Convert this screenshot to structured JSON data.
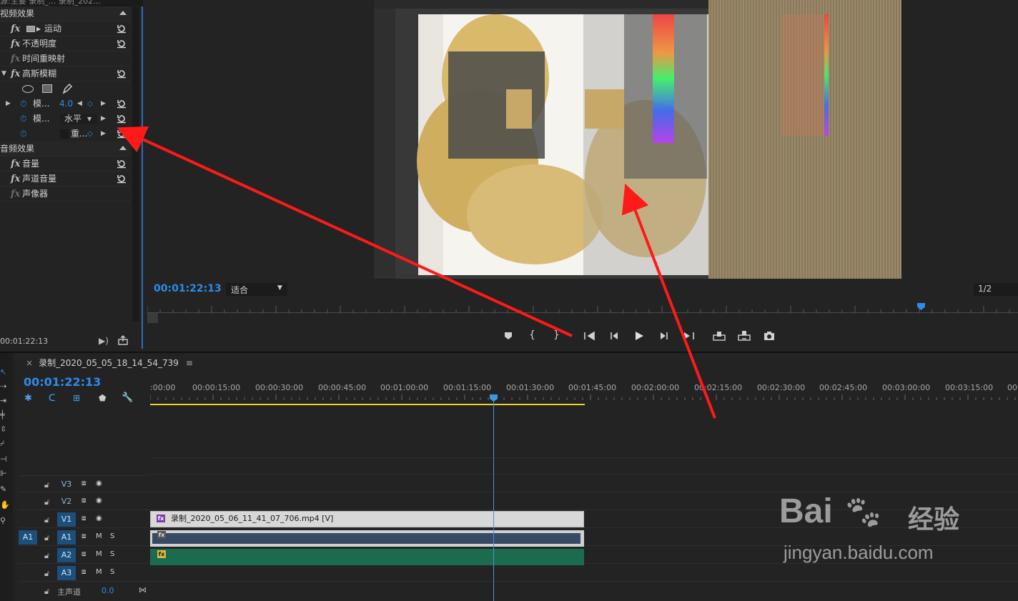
{
  "effect_controls": {
    "tabs_text": "源:主要   录制_...   录制_202...",
    "video_section": "视频效果",
    "effects": [
      "运动",
      "不透明度",
      "时间重映射",
      "高斯模糊"
    ],
    "props": [
      {
        "label": "模...",
        "value": "4.0"
      },
      {
        "label": "模...",
        "value": "水平"
      },
      {
        "label": "重...",
        "value": ""
      }
    ],
    "audio_section": "音频效果",
    "audio_effects": [
      "音量",
      "声道音量",
      "声像器"
    ],
    "timecode": "00:01:22:13"
  },
  "program": {
    "timecode": "00:01:22:13",
    "fit_label": "适合",
    "quality_label": "1/2"
  },
  "timeline": {
    "sequence_name": "录制_2020_05_05_18_14_54_739",
    "timecode": "00:01:22:13",
    "ruler_labels": [
      ":00:00",
      "00:00:15:00",
      "00:00:30:00",
      "00:00:45:00",
      "00:01:00:00",
      "00:01:15:00",
      "00:01:30:00",
      "00:01:45:00",
      "00:02:00:00",
      "00:02:15:00",
      "00:02:30:00",
      "00:02:45:00",
      "00:03:00:00",
      "00:03:15:00",
      "00:"
    ],
    "tracks": {
      "v3": "V3",
      "v2": "V2",
      "v1": "V1",
      "a1_src": "A1",
      "a1": "A1",
      "a2": "A2",
      "a3": "A3",
      "master": "主声道",
      "master_value": "0.0"
    },
    "clip_name": "录制_2020_05_06_11_41_07_706.mp4 [V]"
  },
  "watermark": {
    "brand": "Bai",
    "brand_cn": "经验",
    "url": "jingyan.baidu.com"
  },
  "colors": {
    "accent": "#2d8ceb",
    "video_clip": "#d8d8d8",
    "audio_clip_a1": "#364965",
    "audio_clip_a2": "#1d6b4e",
    "arrow": "#ff1a1a"
  }
}
